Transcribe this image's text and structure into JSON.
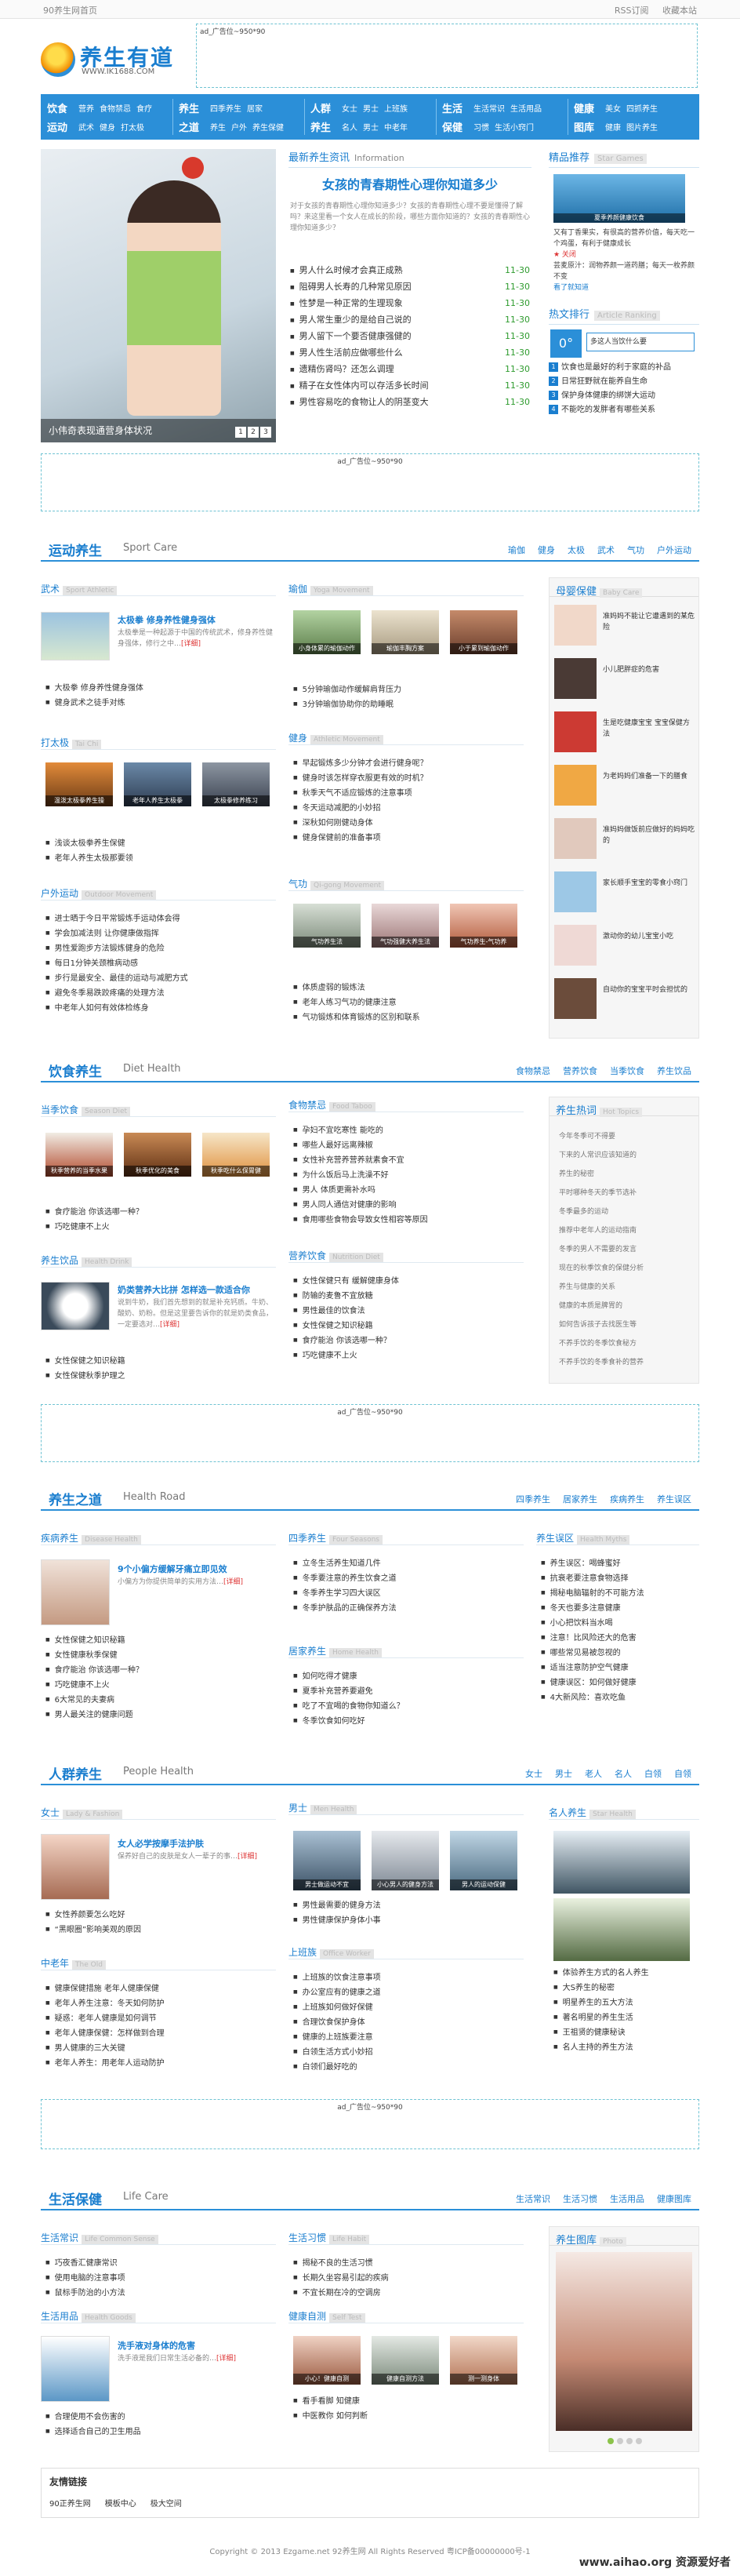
{
  "topbar": {
    "left": "90养生网首页",
    "right1": "RSS订阅",
    "right2": "收藏本站"
  },
  "logo": {
    "name": "养生有道",
    "url": "WWW.IK1688.COM"
  },
  "ads": {
    "top": "ad_广告位~950*90",
    "mid1": "ad_广告位~950*90",
    "mid2": "ad_广告位~950*90",
    "mid3": "ad_广告位~950*90"
  },
  "nav": [
    {
      "k1": "饮食",
      "k2": "运动",
      "s1": [
        "营养",
        "食物禁忌",
        "食疗"
      ],
      "s2": [
        "武术",
        "健身",
        "打太极"
      ]
    },
    {
      "k1": "养生",
      "k2": "之道",
      "s1": [
        "四季养生",
        "居家"
      ],
      "s2": [
        "养生",
        "户外",
        "养生保健"
      ]
    },
    {
      "k1": "人群",
      "k2": "养生",
      "s1": [
        "女士",
        "男士",
        "上班族"
      ],
      "s2": [
        "名人",
        "男士",
        "中老年"
      ]
    },
    {
      "k1": "生活",
      "k2": "保健",
      "s1": [
        "生活常识",
        "生活用品"
      ],
      "s2": [
        "习惯",
        "生活小窍门"
      ]
    },
    {
      "k1": "健康",
      "k2": "图库",
      "s1": [
        "美女",
        "四抓养生"
      ],
      "s2": [
        "健康",
        "图片养生"
      ]
    }
  ],
  "slider": {
    "caption": "小伟奇表现通营身体状况",
    "dots": [
      "1",
      "2",
      "3"
    ]
  },
  "info": {
    "title": "最新养生资讯",
    "en": "Information",
    "headline": "女孩的青春期性心理你知道多少",
    "sub": "对于女孩的青春期性心理你知道多少？女孩的青春期性心理不要是懂得了解吗？来这里看一个女人在成长的阶段，哪些方面你知道的？女孩的青春期性心理你知道多少？",
    "list": [
      [
        "男人什么时候才会真正成熟",
        "11-30"
      ],
      [
        "阻碍男人长寿的几种常见原因",
        "11-30"
      ],
      [
        "性梦是一种正常的生理现象",
        "11-30"
      ],
      [
        "男人常生重少的是给自己说的",
        "11-30"
      ],
      [
        "男人留下一个要否健康强健的",
        "11-30"
      ],
      [
        "男人性生活前应做哪些什么",
        "11-30"
      ],
      [
        "遗精伤肾吗？还怎么调理",
        "11-30"
      ],
      [
        "精子在女性体内可以存活多长时间",
        "11-30"
      ],
      [
        "男性容易吃的食物让人的阴茎变大",
        "11-30"
      ]
    ]
  },
  "hotpic": {
    "title": "精品推荐",
    "en": "Star Games",
    "cap": "夏季养颜健康饮食",
    "txt1": "又有丁香果实，有很高的营养价值，每天吃一个鸡蛋，有利于健康成长",
    "txt2": "★ 关闭",
    "txt3": "芸麦原汁：润物养颜一道药膳；每天一枚养颜不变",
    "txt4": "看了就知道"
  },
  "ranking": {
    "title": "热文排行",
    "en": "Article Ranking",
    "top": "0°",
    "toptxt": "多这人当饮什么要",
    "items": [
      "饮食也是最好的利于家庭的补品",
      "日常狂野就在能养自生命",
      "保护身体健康的绑饼大运动",
      "不能吃的发胖者有哪些关系"
    ]
  },
  "sport": {
    "title": "运动养生",
    "en": "Sport Care",
    "links": [
      "瑜伽",
      "健身",
      "太极",
      "武术",
      "气功",
      "户外运动"
    ],
    "wushu": {
      "title": "武术",
      "en": "Sport Athletic",
      "blk_title": "太极拳 修身养性健身强体",
      "blk_desc": "太极拳是一种起源于中国的传统武术，修身养性健身强体，修行之中…",
      "blk_more": "[详细]",
      "list": [
        "大极拳 修身养性健身强体",
        "健身武术之徒手对练"
      ]
    },
    "taiji": {
      "title": "打太极",
      "en": "Tai Chi",
      "thumbs": [
        "温泼太极拳养生操",
        "老年人养生太极拳",
        "太极拳修养练习"
      ],
      "list": [
        "浅谈太极拳养生保健",
        "老年人养生太极那要领"
      ]
    },
    "outdoor": {
      "title": "户外运动",
      "en": "Outdoor Movement",
      "list": [
        "进士晒于今日平常锻炼手运动体会得",
        "学会加减法则 让你健康做指挥",
        "男性爱跑步方法锻炼健身的危险",
        "每日1分钟关颈椎病动感",
        "步行是最安全、最佳的运动与减肥方式",
        "避免冬季易跌跤疼痛的处理方法",
        "中老年人如何有效体检练身"
      ]
    },
    "yoga": {
      "title": "瑜伽",
      "en": "Yoga Movement",
      "thumbs": [
        "小身体累的瑜伽动作",
        "瑜伽丰胸方案",
        "小于累到瑜伽动作"
      ],
      "list": [
        "5分钟瑜伽动作缓解肩背压力",
        "3分钟瑜伽协助你的助睡眠"
      ]
    },
    "fitness": {
      "title": "健身",
      "en": "Athletic Movement",
      "list": [
        "早起锻炼多少分钟才会进行健身呢？",
        "健身时该怎样穿衣服更有效的时机？",
        "秋季天气不适应锻炼的注意事项",
        "冬天运动减肥的小妙招",
        "深秋如何刚健动身体",
        "健身保健前的准备事项"
      ]
    },
    "qigong": {
      "title": "气功",
      "en": "Qi-gong Movement",
      "thumbs": [
        "气功养生法",
        "气功强健大养生法",
        "气功养生-气功养"
      ],
      "list": [
        "体质虚弱的锻炼法",
        "老年人练习气功的健康注意",
        "气功锻炼和体育锻炼的区别和联系"
      ]
    },
    "baby": {
      "title": "母婴保健",
      "en": "Baby Care",
      "items": [
        "准妈妈不能让它遭遇到的某危险",
        "小儿肥胖症的危害",
        "生是吃健康宝宝 宝宝保健方法",
        "为老妈妈们准备一下的膳食",
        "准妈妈做饭前应做好的妈妈吃的",
        "家长顺手宝宝的零食小窍门",
        "激动你的幼儿宝宝小吃",
        "自动你的宝宝平时会担忧的"
      ]
    }
  },
  "diet": {
    "title": "饮食养生",
    "en": "Diet Health",
    "links": [
      "食物禁忌",
      "营养饮食",
      "当季饮食",
      "养生饮品"
    ],
    "season": {
      "title": "当季饮食",
      "en": "Season Diet",
      "thumbs": [
        "秋季营养的当季水果",
        "秋季优化的美食",
        "秋季吃什么保胃健"
      ],
      "list": [
        "食疗能治 你该选哪一种？",
        "巧吃健康不上火"
      ]
    },
    "drink": {
      "title": "养生饮品",
      "en": "Health Drink",
      "blk_title": "奶类营养大比拼 怎样选一款适合你",
      "blk_desc": "说到牛奶，我们首先想到的就是补充钙质。牛奶、酸奶、奶粉。但是这里要告诉你的就是奶类食品，一定要选对…",
      "blk_more": "[详细]",
      "list": [
        "女性保健之知识秘籍",
        "女性保健秋季护理之"
      ]
    },
    "taboo": {
      "title": "食物禁忌",
      "en": "Food Taboo",
      "list": [
        "孕妇不宜吃寒性 能吃的",
        "哪些人最好远离辣椒",
        "女性补充营养营养就素食不宜",
        "为什么饭后马上洗澡不好",
        "男人 体质更需补水吗",
        "男人同人通信对健康的影响",
        "食用哪些食物会导致女性相容等原因"
      ]
    },
    "nutrition": {
      "title": "营养饮食",
      "en": "Nutrition Diet",
      "list": [
        "女性保健只有 缓解健康身体",
        "防输的麦鲁不宜放糖",
        "男性最佳的饮食法",
        "女性保健之知识秘籍",
        "食疗能治 你该选哪一种？",
        "巧吃健康不上火"
      ]
    },
    "hot": {
      "title": "养生热词",
      "en": "Hot Topics",
      "tags": [
        "今年冬季可不得要",
        "下来的人常识应该知道的",
        "养生的秘密",
        "平时哪种冬天的季节选补",
        "冬季最多的运动",
        "推荐中老年人的运动指南",
        "冬季的男人不需要的发言",
        "现在的秋季饮食的保健分析",
        "养生与健康的关系",
        "健康的本质是脾胃的",
        "如何告诉孩子去找医生等",
        "不养手饮的冬季饮食秘方",
        "不养手饮的冬季食补的营养"
      ]
    }
  },
  "road": {
    "title": "养生之道",
    "en": "Health Road",
    "links": [
      "四季养生",
      "居家养生",
      "疾病养生",
      "养生误区"
    ],
    "disease": {
      "title": "疾病养生",
      "en": "Disease Health",
      "blk_title": "9个小偏方缓解牙痛立即见效",
      "blk_desc": "小偏方为你提供简单的实用方法…",
      "blk_more": "[详细]",
      "list": [
        "女性保健之知识秘籍",
        "女性健康秋季保健",
        "食疗能治 你该选哪一种？",
        "巧吃健康不上火",
        "6大常见的夫妻病",
        "男人最关注的健康问题"
      ]
    },
    "season": {
      "title": "四季养生",
      "en": "Four Seasons",
      "list": [
        "立冬生活养生知道几件",
        "冬季要注意的养生饮食之道",
        "冬季养生学习四大误区",
        "冬季护肤品的正确保养方法"
      ]
    },
    "home": {
      "title": "居家养生",
      "en": "Home Health",
      "list": [
        "如何吃得才健康",
        "夏季补充营养要避免",
        "吃了不宜喝的食物你知道么？",
        "冬季饮食如何吃好"
      ]
    },
    "myth": {
      "title": "养生误区",
      "en": "Health Myths",
      "list": [
        "养生误区：喝蜂蜜好",
        "抗衰老要注意食物选择",
        "揭秘电脑辐射的不可能方法",
        "冬天也要多注意健康",
        "小心把饮料当水喝",
        "注意！比风险还大的危害",
        "哪些常见易被忽视的",
        "适当注意防护空气健康",
        "健康误区：如何做好健康",
        "4大新风险：喜欢吃鱼"
      ]
    }
  },
  "crowd": {
    "title": "人群养生",
    "en": "People Health",
    "links": [
      "女士",
      "男士",
      "老人",
      "名人",
      "白领",
      "自领"
    ],
    "women": {
      "title": "女士",
      "en": "Lady & Fashion",
      "blk_title": "女人必学按摩手法护肤",
      "blk_desc": "保养好自己的皮肤是女人一辈子的事…",
      "blk_more": "[详细]",
      "list": [
        "女性养颜要怎么吃好",
        "“黑眼圈”影响美观的原因"
      ]
    },
    "elder": {
      "title": "中老年",
      "en": "The Old",
      "list": [
        "健康保健措施 老年人健康保健",
        "老年人养生注意：冬天如何防护",
        "疑惑：老年人健康是如何调节",
        "老年人健康保健：怎样做到合理",
        "男人健康的三大关键",
        "老年人养生：用老年人运动防护"
      ]
    },
    "men": {
      "title": "男士",
      "en": "Men Health",
      "thumbs": [
        "男士做运动不宜",
        "小心男人的健身方法",
        "男人的运动保健"
      ],
      "list": [
        "男性最需要的健身方法",
        "男性健康保护身体小事"
      ]
    },
    "office": {
      "title": "上班族",
      "en": "Office Worker",
      "list": [
        "上班族的饮食注意事项",
        "办公室应有的健康之道",
        "上班族如何做好保健",
        "合理饮食保护身体",
        "健康的上班族要注意",
        "白领生活方式小妙招",
        "白领们最好吃的"
      ]
    },
    "celeb": {
      "title": "名人养生",
      "en": "Star Health",
      "list": [
        "体验养生方式的名人养生",
        "大S养生的秘密",
        "明星养生的五大方法",
        "著名明星的养生生活",
        "王祖贤的健康秘诀",
        "名人主持的养生方法"
      ]
    }
  },
  "life": {
    "title": "生活保健",
    "en": "Life Care",
    "links": [
      "生活常识",
      "生活习惯",
      "生活用品",
      "健康图库"
    ],
    "common": {
      "title": "生活常识",
      "en": "Life Common Sense",
      "list": [
        "巧夜香汇健康常识",
        "使用电脑的注意事项",
        "鼠标手防治的小方法"
      ]
    },
    "habit": {
      "title": "生活习惯",
      "en": "Life Habit",
      "list": [
        "揭秘不良的生活习惯",
        "长期久坐容易引起的疾病",
        "不宜长期在冷的空调房"
      ]
    },
    "goods": {
      "title": "生活用品",
      "en": "Health Goods",
      "blk_title": "洗手液对身体的危害",
      "blk_desc": "洗手液是我们日常生活必备的…",
      "blk_more": "[详细]",
      "list": [
        "合理使用不会伤害的",
        "选择适合自己的卫生用品"
      ]
    },
    "pics": {
      "title": "健康自测",
      "en": "Self Test",
      "thumbs": [
        "小心！健康自测",
        "健康自测方法",
        "测一测身体"
      ],
      "list": [
        "看手看脚 知健康",
        "中医教你 如何判断"
      ]
    },
    "gallery": {
      "title": "养生图库",
      "en": "Photo"
    }
  },
  "friendlinks": {
    "title": "友情链接",
    "items": [
      "90正养生网",
      "模板中心",
      "极大空间"
    ]
  },
  "copyright": "Copyright © 2013 Ezgame.net 92养生网 All Rights Reserved 粤ICP备00000000号-1",
  "watermark": "www.aihao.org 资源爱好者",
  "colors": {
    "accent": "#1a7ecf",
    "nav": "#2b8fd8",
    "date": "#2e9b2e"
  }
}
